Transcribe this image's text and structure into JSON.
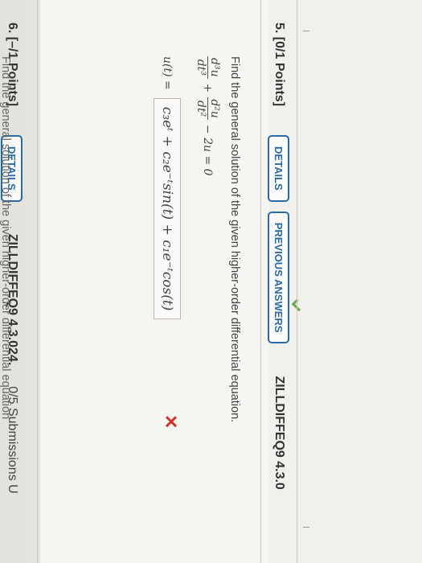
{
  "question5": {
    "number": "5.",
    "points": "[0/1 Points]",
    "details_label": "DETAILS",
    "previous_answers_label": "PREVIOUS ANSWERS",
    "reference": "ZILLDIFFEQ9 4.3.0",
    "prompt": "Find the general solution of the given higher-order differential equation.",
    "equation": {
      "term1_num": "d³u",
      "term1_den": "dt³",
      "plus": "+",
      "term2_num": "d²u",
      "term2_den": "dt²",
      "rest": "− 2u = 0"
    },
    "answer_label": "u(t) =",
    "answer_value": "c₃eᵗ + c₂e⁻ᵗsin(t) + c₁e⁻ᵗcos(t)",
    "result_icon": "x-mark-icon"
  },
  "question6": {
    "number": "6.",
    "points": "[–/1 Points]",
    "details_label": "DETAILS",
    "reference": "ZILLDIFFEQ9 4.3.024.",
    "submissions": "0/5 Submissions U",
    "prompt_cut": "Find the general solution of the given higher-order differential equation"
  },
  "colors": {
    "accent": "#2b6aa6",
    "wrong": "#d0312d",
    "correct": "#6aa84f"
  }
}
